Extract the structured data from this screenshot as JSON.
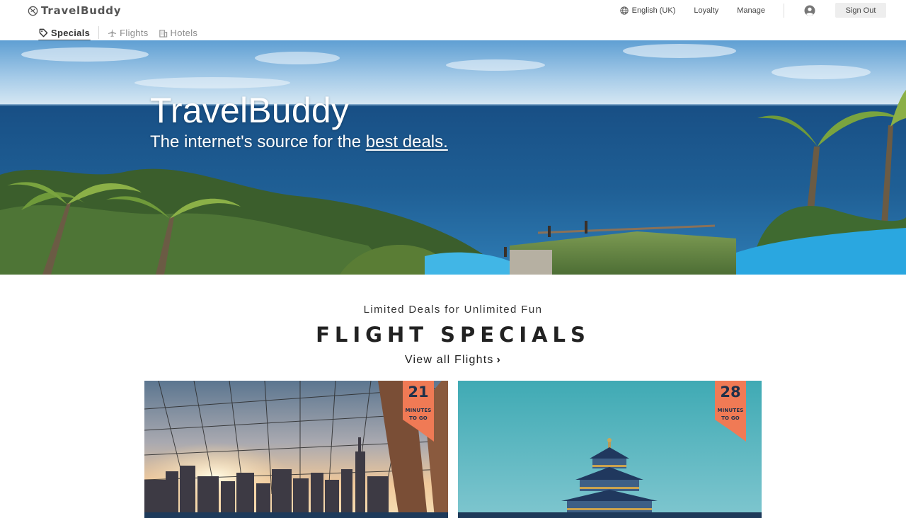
{
  "header": {
    "brand": "TravelBuddy",
    "tabs": [
      {
        "label": "Specials",
        "icon": "tag-icon",
        "active": true
      },
      {
        "label": "Flights",
        "icon": "plane-icon",
        "active": false
      },
      {
        "label": "Hotels",
        "icon": "building-icon",
        "active": false
      }
    ],
    "nav": {
      "language": "English (UK)",
      "loyalty": "Loyalty",
      "manage": "Manage",
      "sign_out": "Sign Out"
    }
  },
  "hero": {
    "title": "TravelBuddy",
    "subtitle_prefix": "The internet's source for the ",
    "subtitle_link": "best deals."
  },
  "specials": {
    "tagline": "Limited Deals for Unlimited Fun",
    "title": "FLIGHT SPECIALS",
    "view_all": "View all Flights",
    "cards": [
      {
        "minutes": "21",
        "label_line1": "MINUTES",
        "label_line2": "TO GO"
      },
      {
        "minutes": "28",
        "label_line1": "MINUTES",
        "label_line2": "TO GO"
      }
    ]
  },
  "colors": {
    "ribbon": "#f07a55",
    "card_bar": "#1e3a5a",
    "sky": "#7fb3d9",
    "ocean": "#1f5f95"
  }
}
